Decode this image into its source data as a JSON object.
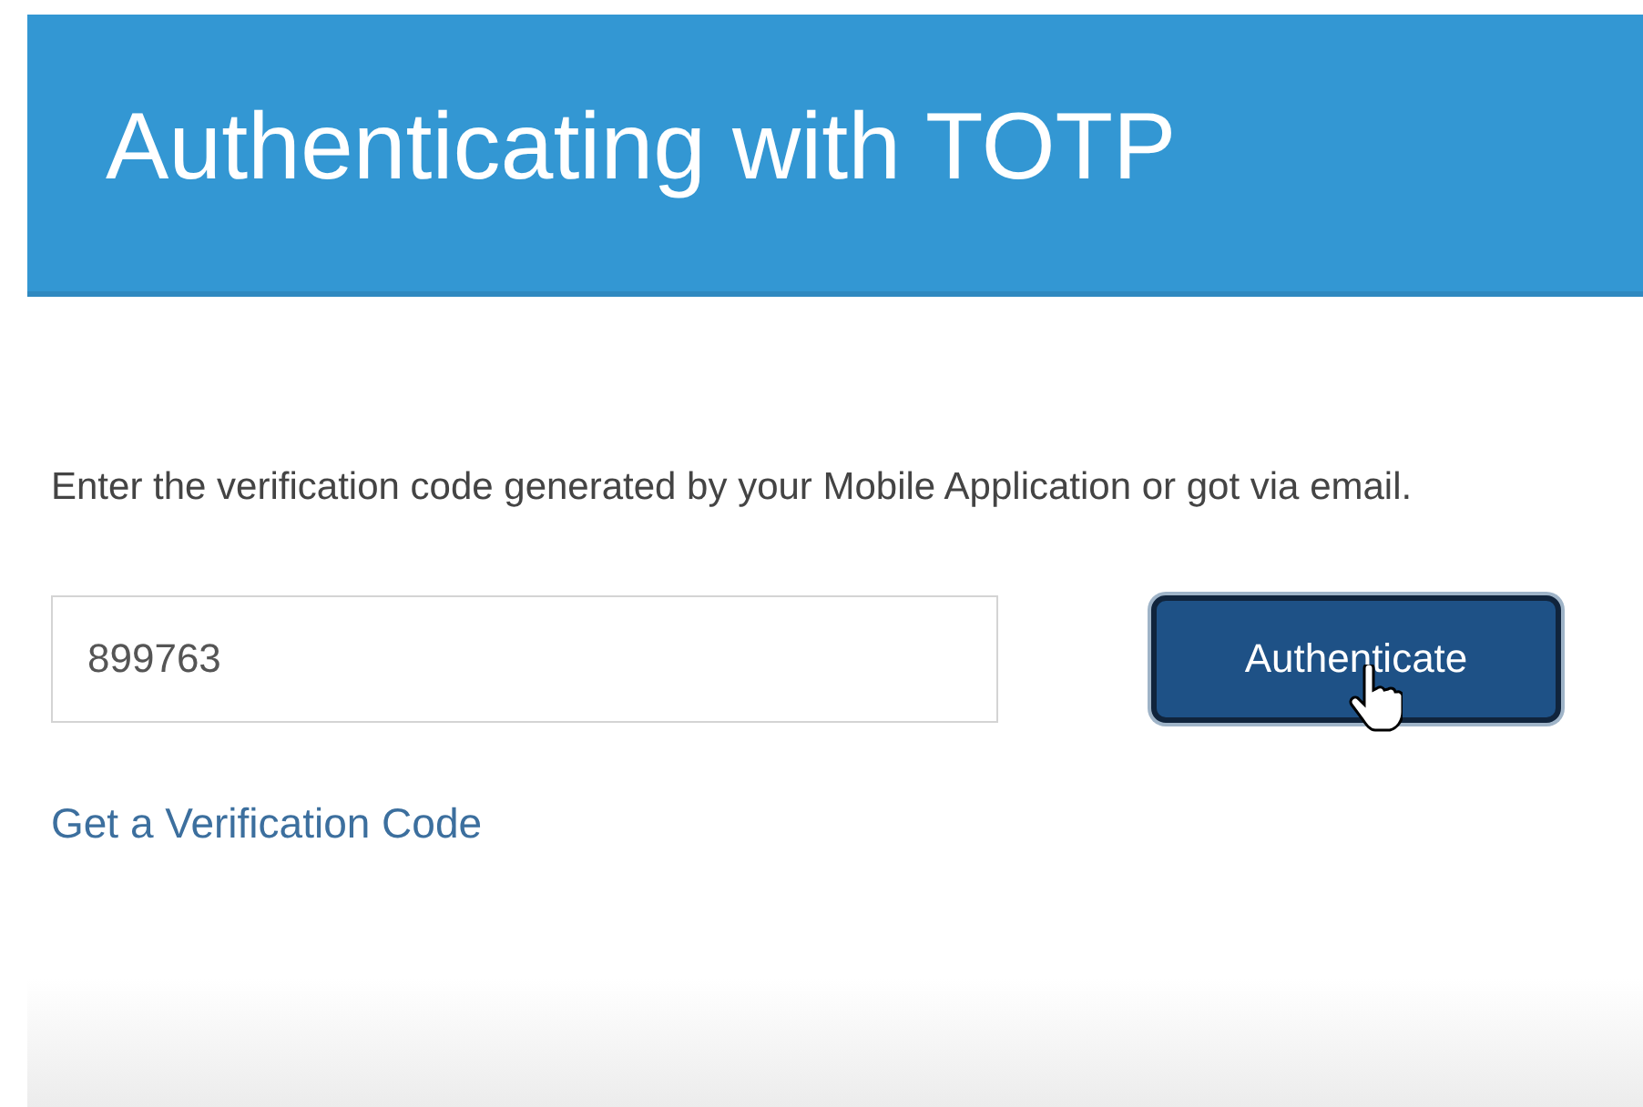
{
  "header": {
    "title": "Authenticating with TOTP"
  },
  "instructions": "Enter the verification code generated by your Mobile Application or got via email.",
  "code_field": {
    "value": "899763"
  },
  "authenticate_button": {
    "label": "Authenticate"
  },
  "link": "Get a Verification Code"
}
